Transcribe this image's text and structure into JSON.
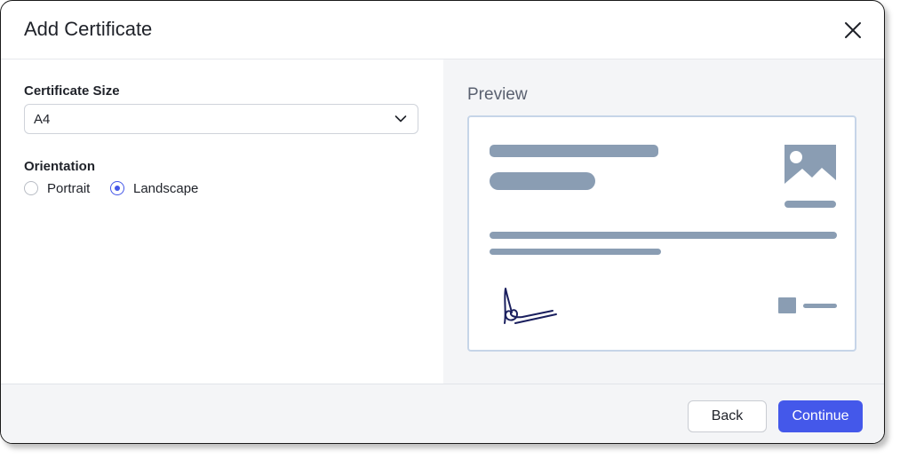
{
  "dialog": {
    "title": "Add Certificate",
    "close_icon": "close-icon"
  },
  "form": {
    "size": {
      "label": "Certificate Size",
      "value": "A4",
      "icon": "chevron-down-icon"
    },
    "orientation": {
      "label": "Orientation",
      "options": [
        {
          "label": "Portrait",
          "selected": false
        },
        {
          "label": "Landscape",
          "selected": true
        }
      ]
    }
  },
  "preview": {
    "title": "Preview",
    "image_icon": "image-icon",
    "signature": "signature-scribble"
  },
  "footer": {
    "back_label": "Back",
    "continue_label": "Continue"
  },
  "colors": {
    "accent": "#4458ea",
    "placeholder": "#8a9db3",
    "card_border": "#c6d5e8",
    "panel_bg": "#f4f5f7",
    "signature": "#1a1f5e"
  }
}
